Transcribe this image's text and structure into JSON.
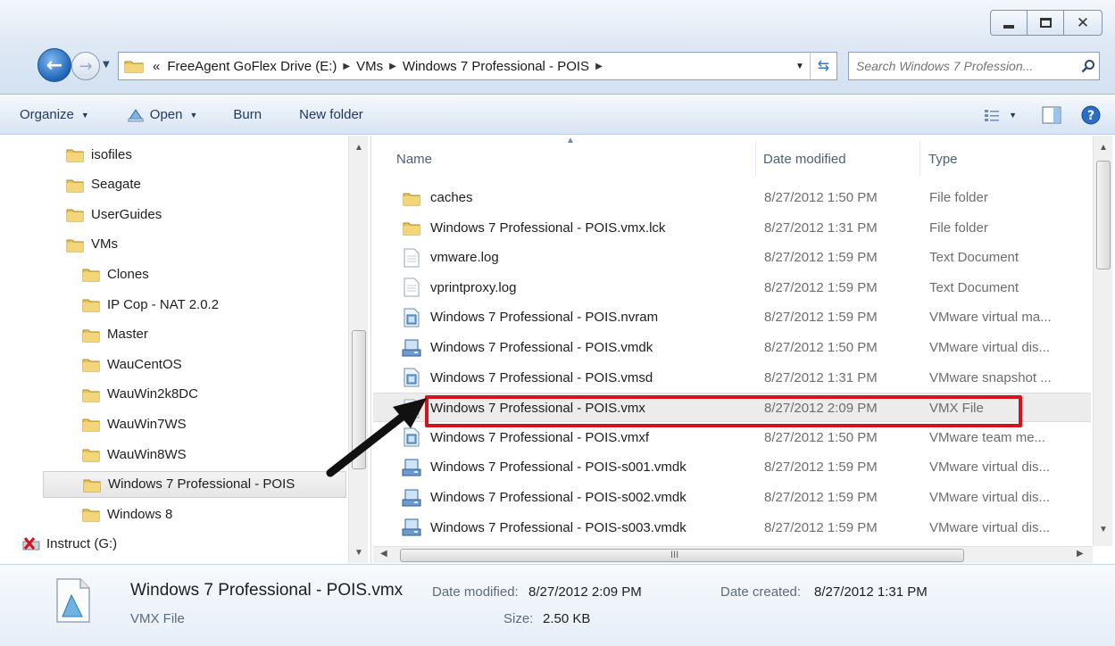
{
  "address": {
    "overflow": "«",
    "crumbs": [
      "FreeAgent GoFlex Drive (E:)",
      "VMs",
      "Windows 7 Professional - POIS"
    ]
  },
  "search": {
    "placeholder": "Search Windows 7 Profession..."
  },
  "toolbar": {
    "organize": "Organize",
    "open": "Open",
    "burn": "Burn",
    "new_folder": "New folder"
  },
  "nav": {
    "items": [
      {
        "label": "isofiles"
      },
      {
        "label": "Seagate"
      },
      {
        "label": "UserGuides"
      },
      {
        "label": "VMs"
      },
      {
        "label": "Clones"
      },
      {
        "label": "IP Cop - NAT 2.0.2"
      },
      {
        "label": "Master"
      },
      {
        "label": "WauCentOS"
      },
      {
        "label": "WauWin2k8DC"
      },
      {
        "label": "WauWin7WS"
      },
      {
        "label": "WauWin8WS"
      },
      {
        "label": "Windows 7 Professional - POIS"
      },
      {
        "label": "Windows 8"
      },
      {
        "label": "Instruct (G:)"
      }
    ]
  },
  "columns": {
    "name": "Name",
    "date": "Date modified",
    "type": "Type"
  },
  "files": [
    {
      "name": "caches",
      "date": "8/27/2012 1:50 PM",
      "type": "File folder",
      "icon": "folder-icon"
    },
    {
      "name": "Windows 7 Professional - POIS.vmx.lck",
      "date": "8/27/2012 1:31 PM",
      "type": "File folder",
      "icon": "folder-icon"
    },
    {
      "name": "vmware.log",
      "date": "8/27/2012 1:59 PM",
      "type": "Text Document",
      "icon": "text-document-icon"
    },
    {
      "name": "vprintproxy.log",
      "date": "8/27/2012 1:59 PM",
      "type": "Text Document",
      "icon": "text-document-icon"
    },
    {
      "name": "Windows 7 Professional - POIS.nvram",
      "date": "8/27/2012 1:59 PM",
      "type": "VMware virtual ma...",
      "icon": "vmware-file-icon"
    },
    {
      "name": "Windows 7 Professional - POIS.vmdk",
      "date": "8/27/2012 1:50 PM",
      "type": "VMware virtual dis...",
      "icon": "virtual-disk-icon"
    },
    {
      "name": "Windows 7 Professional - POIS.vmsd",
      "date": "8/27/2012 1:31 PM",
      "type": "VMware snapshot ...",
      "icon": "vmware-file-icon"
    },
    {
      "name": "Windows 7 Professional - POIS.vmx",
      "date": "8/27/2012 2:09 PM",
      "type": "VMX File",
      "icon": "generic-file-icon"
    },
    {
      "name": "Windows 7 Professional - POIS.vmxf",
      "date": "8/27/2012 1:50 PM",
      "type": "VMware team me...",
      "icon": "vmware-file-icon"
    },
    {
      "name": "Windows 7 Professional - POIS-s001.vmdk",
      "date": "8/27/2012 1:59 PM",
      "type": "VMware virtual dis...",
      "icon": "virtual-disk-icon"
    },
    {
      "name": "Windows 7 Professional - POIS-s002.vmdk",
      "date": "8/27/2012 1:59 PM",
      "type": "VMware virtual dis...",
      "icon": "virtual-disk-icon"
    },
    {
      "name": "Windows 7 Professional - POIS-s003.vmdk",
      "date": "8/27/2012 1:59 PM",
      "type": "VMware virtual dis...",
      "icon": "virtual-disk-icon"
    }
  ],
  "selected_file": "Windows 7 Professional - POIS.vmx",
  "details": {
    "name": "Windows 7 Professional - POIS.vmx",
    "type": "VMX File",
    "date_modified_label": "Date modified:",
    "date_modified": "8/27/2012 2:09 PM",
    "size_label": "Size:",
    "size": "2.50 KB",
    "date_created_label": "Date created:",
    "date_created": "8/27/2012 1:31 PM"
  },
  "scroll_glyph": "III",
  "colors": {
    "highlight": "#d4131a",
    "arrow": "#111111",
    "folder": "#e8c25a",
    "title": "#dfe9f5"
  }
}
